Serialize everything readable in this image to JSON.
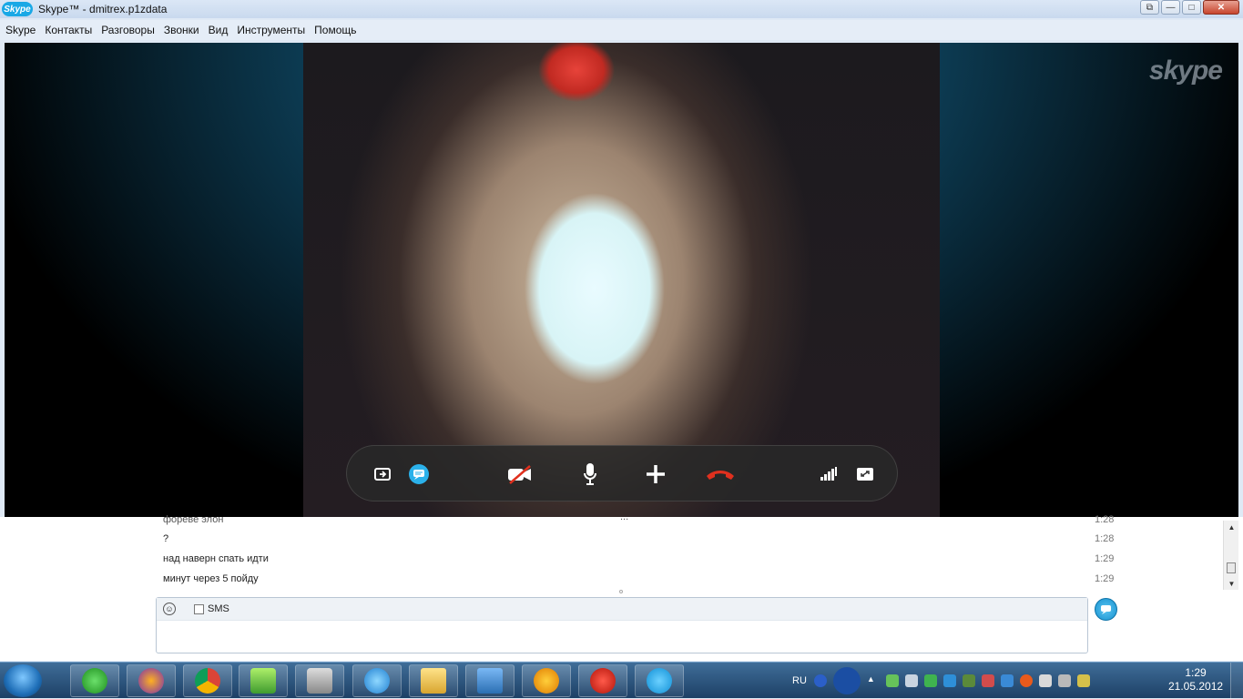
{
  "window": {
    "logo_text": "Skype",
    "title": "Skype™ - dmitrex.p1zdata",
    "buttons": {
      "restore": "⧉",
      "minimize": "—",
      "maximize": "□",
      "close": "✕"
    }
  },
  "menu": {
    "items": [
      "Skype",
      "Контакты",
      "Разговоры",
      "Звонки",
      "Вид",
      "Инструменты",
      "Помощь"
    ]
  },
  "video": {
    "watermark": "skype"
  },
  "call_toolbar": {
    "icons": [
      "share-screen-icon",
      "chat-icon",
      "video-off-icon",
      "microphone-icon",
      "add-icon",
      "hang-up-icon",
      "signal-icon",
      "fullscreen-icon"
    ],
    "hangup_color": "#e0301e",
    "chat_color": "#2bb1ea"
  },
  "chat": {
    "messages": [
      {
        "text": "фореве элон",
        "time": "1:28"
      },
      {
        "text": "?",
        "time": "1:28"
      },
      {
        "text": "над наверн спать идти",
        "time": "1:29"
      },
      {
        "text": "минут через 5 пойду",
        "time": "1:29"
      }
    ],
    "more_indicator": "...",
    "sms_label": "SMS"
  },
  "taskbar": {
    "apps": [
      "network-icon",
      "purple-app-icon",
      "chrome-icon",
      "file-manager-icon",
      "robot-icon",
      "internet-explorer-icon",
      "folder-icon",
      "transfer-icon",
      "aimp-icon",
      "angry-birds-icon",
      "skype-icon"
    ],
    "language": "RU",
    "time": "1:29",
    "date": "21.05.2012"
  },
  "colors": {
    "accent": "#19a8e6",
    "taskbar": "#1d4066"
  }
}
